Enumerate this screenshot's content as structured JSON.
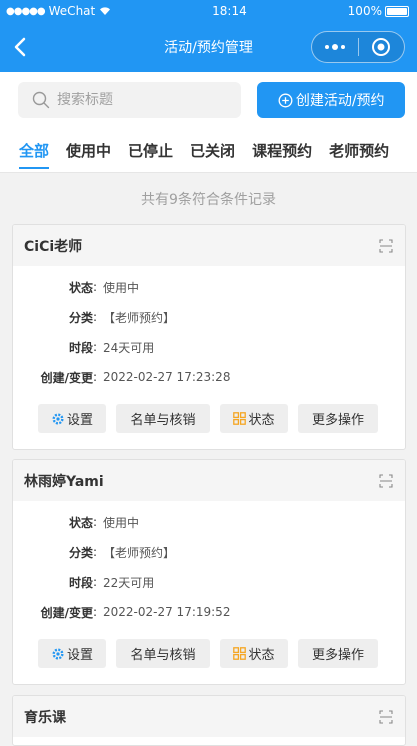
{
  "status_bar": {
    "carrier": "WeChat",
    "time": "18:14",
    "battery": "100%"
  },
  "nav": {
    "title": "活动/预约管理"
  },
  "search": {
    "placeholder": "搜索标题"
  },
  "create_button": {
    "label": "创建活动/预约"
  },
  "tabs": [
    {
      "label": "全部",
      "active": true
    },
    {
      "label": "使用中"
    },
    {
      "label": "已停止"
    },
    {
      "label": "已关闭"
    },
    {
      "label": "课程预约"
    },
    {
      "label": "老师预约"
    }
  ],
  "records_count": "共有9条符合条件记录",
  "labels": {
    "status": "状态",
    "category": "分类",
    "period": "时段",
    "created": "创建/变更",
    "colon": ":"
  },
  "cards": [
    {
      "title": "CiCi老师",
      "status": "使用中",
      "category": "【老师预约】",
      "period": "24天可用",
      "created": "2022-02-27 17:23:28",
      "actions": {
        "settings": "设置",
        "list": "名单与核销",
        "status": "状态",
        "more": "更多操作"
      }
    },
    {
      "title": "林雨婷Yami",
      "status": "使用中",
      "category": "【老师预约】",
      "period": "22天可用",
      "created": "2022-02-27 17:19:52",
      "actions": {
        "settings": "设置",
        "list": "名单与核销",
        "status": "状态",
        "more": "更多操作"
      }
    },
    {
      "title": "育乐课"
    }
  ],
  "colors": {
    "primary": "#2196f3",
    "settings_icon": "#2196f3",
    "status_icon": "#f5a623"
  }
}
